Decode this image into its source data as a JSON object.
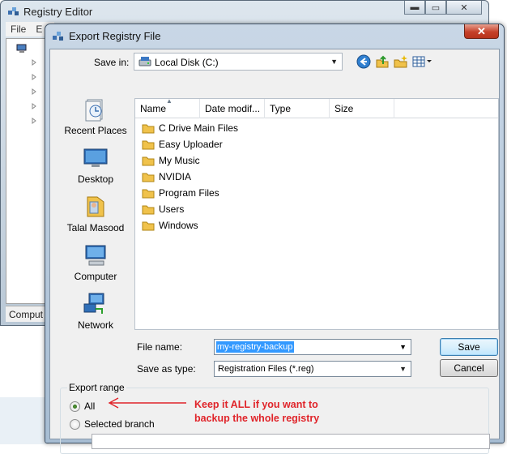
{
  "background_window": {
    "title": "Registry Editor",
    "menu": [
      "File",
      "E"
    ],
    "status": "Comput",
    "controls": [
      "▬",
      "▭",
      "✕"
    ]
  },
  "dialog": {
    "title": "Export Registry File",
    "close": "✕",
    "save_in": {
      "label": "Save in:",
      "value": "Local Disk (C:)",
      "icon": "hard-drive-icon"
    },
    "toolbar": [
      "back-icon",
      "up-folder-icon",
      "new-folder-icon",
      "view-menu-icon"
    ],
    "places": [
      {
        "label": "Recent Places",
        "icon": "recent-places-icon"
      },
      {
        "label": "Desktop",
        "icon": "desktop-icon"
      },
      {
        "label": "Talal Masood",
        "icon": "user-folder-icon"
      },
      {
        "label": "Computer",
        "icon": "computer-icon"
      },
      {
        "label": "Network",
        "icon": "network-icon"
      }
    ],
    "columns": [
      "Name",
      "Date modif...",
      "Type",
      "Size"
    ],
    "files": [
      "C Drive Main Files",
      "Easy Uploader",
      "My Music",
      "NVIDIA",
      "Program Files",
      "Users",
      "Windows"
    ],
    "file_name": {
      "label": "File name:",
      "value": "my-registry-backup"
    },
    "save_as_type": {
      "label": "Save as type:",
      "value": "Registration Files (*.reg)"
    },
    "save_button": "Save",
    "cancel_button": "Cancel",
    "export_range": {
      "title": "Export range",
      "all_label": "All",
      "selected_branch_label": "Selected branch",
      "selected": "All",
      "branch_value": ""
    }
  },
  "annotation": {
    "line1": "Keep it ALL if you want to",
    "line2": "backup the whole registry",
    "color": "#e0242a"
  }
}
